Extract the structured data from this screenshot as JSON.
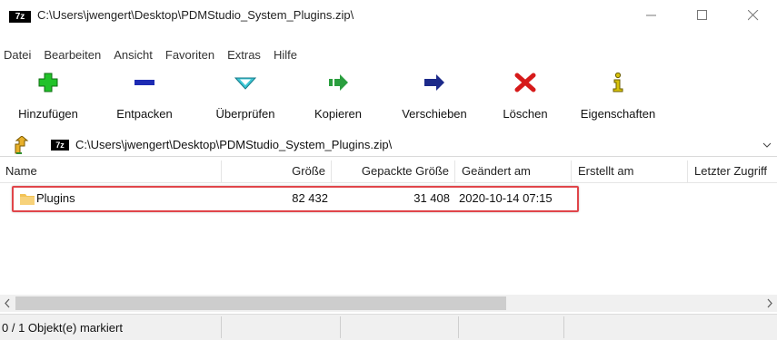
{
  "window": {
    "title": "C:\\Users\\jwengert\\Desktop\\PDMStudio_System_Plugins.zip\\",
    "app_logo": "7z"
  },
  "menu": [
    "Datei",
    "Bearbeiten",
    "Ansicht",
    "Favoriten",
    "Extras",
    "Hilfe"
  ],
  "toolbar": {
    "buttons": [
      {
        "label": "Hinzufügen",
        "icon": "plus-icon",
        "color": "#22c22a"
      },
      {
        "label": "Entpacken",
        "icon": "minus-icon",
        "color": "#1d2bb3"
      },
      {
        "label": "Überprüfen",
        "icon": "check-chevron-icon",
        "color": "#3cc6d4"
      },
      {
        "label": "Kopieren",
        "icon": "copy-arrow-icon",
        "color": "#2a9e3e"
      },
      {
        "label": "Verschieben",
        "icon": "move-arrow-icon",
        "color": "#1c2a8a"
      },
      {
        "label": "Löschen",
        "icon": "delete-x-icon",
        "color": "#d61a1a"
      },
      {
        "label": "Eigenschaften",
        "icon": "info-icon",
        "color": "#d7c20a"
      }
    ]
  },
  "address": {
    "path": "C:\\Users\\jwengert\\Desktop\\PDMStudio_System_Plugins.zip\\",
    "logo": "7z"
  },
  "columns": [
    "Name",
    "Größe",
    "Gepackte Größe",
    "Geändert am",
    "Erstellt am",
    "Letzter Zugriff"
  ],
  "rows": [
    {
      "name": "Plugins",
      "size": "82 432",
      "packed": "31 408",
      "modified": "2020-10-14 07:15",
      "created": "",
      "accessed": ""
    }
  ],
  "status": {
    "selection": "0 / 1 Objekt(e) markiert"
  },
  "colors": {
    "highlight": "#e0454a",
    "folder": "#f2c355"
  }
}
